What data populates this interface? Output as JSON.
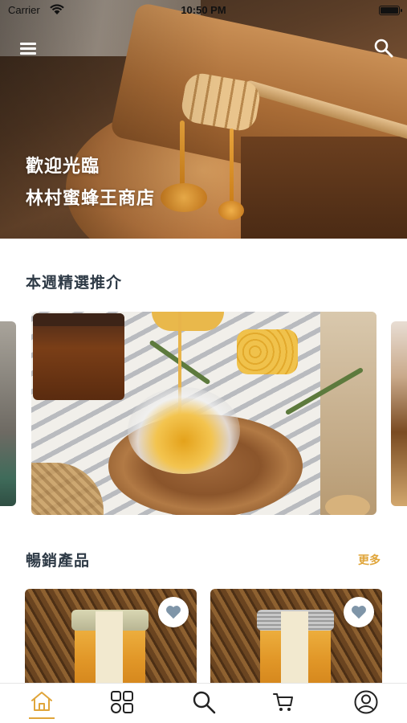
{
  "status_bar": {
    "carrier": "Carrier",
    "time": "10:50 PM"
  },
  "hero": {
    "line1": "歡迎光臨",
    "line2": "林村蜜蜂王商店"
  },
  "featured": {
    "title": "本週精選推介"
  },
  "bestsellers": {
    "title": "暢銷產品",
    "more_label": "更多",
    "products": [
      {
        "favorite": false
      },
      {
        "favorite": false
      }
    ]
  },
  "tab_bar": {
    "active_tab": "home",
    "tabs": [
      "home-icon",
      "category-grid-icon",
      "search-icon",
      "cart-icon",
      "profile-icon"
    ]
  },
  "colors": {
    "accent": "#e0a53a",
    "title_text": "#2e3a46",
    "icon": "#222222"
  }
}
